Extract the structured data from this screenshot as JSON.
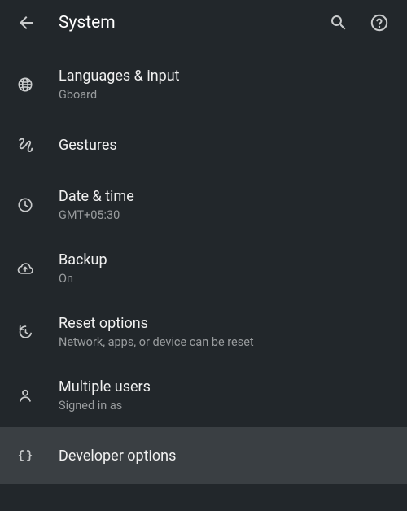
{
  "header": {
    "title": "System"
  },
  "items": [
    {
      "icon": "globe",
      "title": "Languages & input",
      "subtitle": "Gboard",
      "highlight": false
    },
    {
      "icon": "gesture",
      "title": "Gestures",
      "subtitle": "",
      "highlight": false
    },
    {
      "icon": "time",
      "title": "Date & time",
      "subtitle": "GMT+05:30",
      "highlight": false
    },
    {
      "icon": "cloudup",
      "title": "Backup",
      "subtitle": "On",
      "highlight": false
    },
    {
      "icon": "restore",
      "title": "Reset options",
      "subtitle": "Network, apps, or device can be reset",
      "highlight": false
    },
    {
      "icon": "person",
      "title": "Multiple users",
      "subtitle": "Signed in as",
      "highlight": false
    },
    {
      "icon": "braces",
      "title": "Developer options",
      "subtitle": "",
      "highlight": true
    }
  ]
}
